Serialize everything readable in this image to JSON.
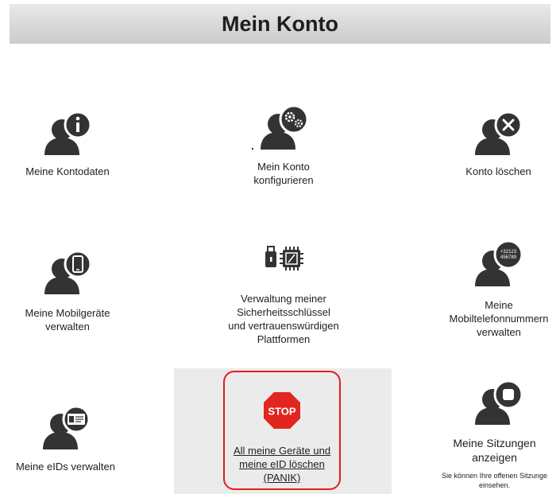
{
  "header": {
    "title": "Mein Konto"
  },
  "tiles": [
    {
      "label": "Meine Kontodaten",
      "icon": "person-info-icon"
    },
    {
      "label": "Mein Konto\nkonfigurieren",
      "icon": "person-settings-icon"
    },
    {
      "label": "Konto löschen",
      "icon": "person-delete-icon"
    },
    {
      "label": "Meine Mobilgeräte\nverwalten",
      "icon": "person-mobile-icon"
    },
    {
      "label": "Verwaltung meiner\nSicherheitsschlüssel\nund vertrauenswürdigen\nPlattformen",
      "icon": "security-key-chip-icon"
    },
    {
      "label": "Meine\nMobiltelefonnummern\nverwalten",
      "icon": "person-phone-number-icon",
      "badge_text": "+32123\n456789"
    },
    {
      "label": "Meine eIDs verwalten",
      "icon": "person-id-card-icon"
    },
    {
      "label": "All meine Geräte und\nmeine eID löschen\n(PANIK)",
      "icon": "stop-sign-icon",
      "badge_text": "STOP"
    },
    {
      "label": "Meine Sitzungen\nanzeigen",
      "icon": "person-sessions-icon",
      "sub": "Sie können Ihre offenen Sitzunge\neinsehen."
    }
  ],
  "colors": {
    "icon": "#333333",
    "stop": "#e0261f",
    "panic_border": "#e31d1d",
    "panic_bg": "#ebebeb"
  }
}
